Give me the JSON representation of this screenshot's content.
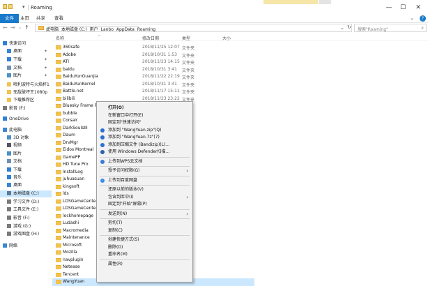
{
  "window": {
    "title": "Roaming",
    "controls": [
      "—",
      "☐",
      "✕"
    ]
  },
  "ribbon": {
    "tabs": [
      "文件",
      "主页",
      "共享",
      "查看"
    ],
    "expand": "⌄",
    "help": "?"
  },
  "address": {
    "breadcrumbs": [
      "此电脑",
      "本地磁盘 (C:)",
      "用户",
      "Lanbo",
      "AppData",
      "Roaming"
    ],
    "search_placeholder": "搜索\"Roaming\""
  },
  "sidebar": {
    "items": [
      {
        "label": "快速访问",
        "icon": "star-icon",
        "color": "#2f7fd6"
      },
      {
        "label": "桌面",
        "icon": "desktop-icon",
        "color": "#3b86d4",
        "pin": "✦"
      },
      {
        "label": "下载",
        "icon": "download-icon",
        "color": "#2f7fd6",
        "pin": "✦"
      },
      {
        "label": "文档",
        "icon": "document-icon",
        "color": "#6f8fb6",
        "pin": "✦"
      },
      {
        "label": "图片",
        "icon": "picture-icon",
        "color": "#4a90c8",
        "pin": "✦"
      },
      {
        "label": "哈利波特与火焰杯1",
        "icon": "folder-icon",
        "color": "#f2c14e"
      },
      {
        "label": "无敌破坏王1080p",
        "icon": "folder-icon",
        "color": "#f2c14e"
      },
      {
        "label": "下载推荐区",
        "icon": "folder-icon",
        "color": "#f2c14e"
      },
      {
        "label": "影音 (F:)",
        "icon": "drive-icon",
        "color": "#7a7a7a"
      },
      {
        "label": "OneDrive",
        "icon": "cloud-icon",
        "color": "#2f7fd6"
      },
      {
        "label": "此电脑",
        "icon": "computer-icon",
        "color": "#3b86d4"
      },
      {
        "label": "3D 对象",
        "icon": "cube-icon",
        "color": "#4a90c8"
      },
      {
        "label": "视频",
        "icon": "video-icon",
        "color": "#556"
      },
      {
        "label": "图片",
        "icon": "picture-icon",
        "color": "#4a90c8"
      },
      {
        "label": "文档",
        "icon": "document-icon",
        "color": "#6f8fb6"
      },
      {
        "label": "下载",
        "icon": "download-icon",
        "color": "#2f7fd6"
      },
      {
        "label": "音乐",
        "icon": "music-icon",
        "color": "#2f7fd6"
      },
      {
        "label": "桌面",
        "icon": "desktop-icon",
        "color": "#3b86d4"
      },
      {
        "label": "本地磁盘 (C:)",
        "icon": "drive-icon",
        "color": "#5a7a9a",
        "selected": true
      },
      {
        "label": "学习文件 (D:)",
        "icon": "drive-icon",
        "color": "#7a7a7a"
      },
      {
        "label": "工具文件 (E:)",
        "icon": "drive-icon",
        "color": "#7a7a7a"
      },
      {
        "label": "影音 (F:)",
        "icon": "drive-icon",
        "color": "#7a7a7a"
      },
      {
        "label": "游戏 (G:)",
        "icon": "drive-icon",
        "color": "#7a7a7a"
      },
      {
        "label": "游戏图盘 (H:)",
        "icon": "drive-icon",
        "color": "#7a7a7a"
      },
      {
        "label": "网络",
        "icon": "network-icon",
        "color": "#3b86d4"
      }
    ]
  },
  "columns": {
    "name": "名称",
    "date": "修改日期",
    "type": "类型",
    "size": "大小"
  },
  "files": [
    {
      "name": "360safe",
      "date": "2018/11/25 12:07",
      "type": "文件夹"
    },
    {
      "name": "Adobe",
      "date": "2018/10/31 1:53",
      "type": "文件夹"
    },
    {
      "name": "ATI",
      "date": "2018/11/23 14:15",
      "type": "文件夹"
    },
    {
      "name": "baidu",
      "date": "2018/10/31 3:41",
      "type": "文件夹"
    },
    {
      "name": "BaiduYunGuanjia",
      "date": "2018/11/22 22:19",
      "type": "文件夹"
    },
    {
      "name": "BaiduYunKernel",
      "date": "2018/10/31 3:41",
      "type": "文件夹"
    },
    {
      "name": "Battle.net",
      "date": "2018/11/17 15:11",
      "type": "文件夹"
    },
    {
      "name": "bilibili",
      "date": "2018/11/23 23:22",
      "type": "文件夹"
    },
    {
      "name": "Bluesky Frame Ra",
      "date": "",
      "type": ""
    },
    {
      "name": "bubble",
      "date": "",
      "type": ""
    },
    {
      "name": "Corsair",
      "date": "",
      "type": ""
    },
    {
      "name": "DarkSoulsIII",
      "date": "",
      "type": ""
    },
    {
      "name": "Daum",
      "date": "",
      "type": ""
    },
    {
      "name": "DrvMgr",
      "date": "",
      "type": ""
    },
    {
      "name": "Eidos Montreal",
      "date": "",
      "type": ""
    },
    {
      "name": "GamePP",
      "date": "",
      "type": ""
    },
    {
      "name": "HD Tune Pro",
      "date": "",
      "type": ""
    },
    {
      "name": "InstallLog",
      "date": "",
      "type": ""
    },
    {
      "name": "juhuasuan",
      "date": "",
      "type": ""
    },
    {
      "name": "kingsoft",
      "date": "",
      "type": ""
    },
    {
      "name": "lds",
      "date": "",
      "type": ""
    },
    {
      "name": "LDSGameCenter",
      "date": "",
      "type": ""
    },
    {
      "name": "LDSGameCenterS",
      "date": "",
      "type": ""
    },
    {
      "name": "lockhomepage",
      "date": "",
      "type": ""
    },
    {
      "name": "Ludashi",
      "date": "",
      "type": ""
    },
    {
      "name": "Macromedia",
      "date": "",
      "type": ""
    },
    {
      "name": "Maintenance",
      "date": "",
      "type": ""
    },
    {
      "name": "Microsoft",
      "date": "",
      "type": ""
    },
    {
      "name": "Mozilla",
      "date": "",
      "type": ""
    },
    {
      "name": "navplugin",
      "date": "",
      "type": ""
    },
    {
      "name": "Netease",
      "date": "",
      "type": ""
    },
    {
      "name": "Tencent",
      "date": "",
      "type": ""
    },
    {
      "name": "WangYuan",
      "date": "",
      "type": "",
      "selected": true
    }
  ],
  "context_menu": {
    "items": [
      {
        "label": "打开(O)",
        "bold": true
      },
      {
        "label": "在新窗口中打开(E)"
      },
      {
        "label": "固定到\"快速访问\""
      },
      {
        "label": "添加到 \"WangYuan.zip\"(Q)",
        "icon": "bandizip-icon",
        "icon_color": "#2a6fd1"
      },
      {
        "label": "添加到 \"WangYuan.7z\"(7)",
        "icon": "bandizip-icon",
        "icon_color": "#2a6fd1"
      },
      {
        "label": "添加到压缩文件 (Bandizip)(L)...",
        "icon": "bandizip-icon",
        "icon_color": "#2a6fd1"
      },
      {
        "label": "使用 Windows Defender扫描...",
        "icon": "defender-icon",
        "icon_color": "#2f5fb0"
      },
      {
        "sep": true
      },
      {
        "label": "上传到WPS云文档",
        "icon": "wps-cloud-icon",
        "icon_color": "#3a7bd5"
      },
      {
        "sep": true
      },
      {
        "label": "授予访问权限(G)",
        "arrow": "›"
      },
      {
        "sep": true
      },
      {
        "label": "上传到百度网盘",
        "icon": "baidu-netdisk-icon",
        "icon_color": "#3b8ee8"
      },
      {
        "sep": true
      },
      {
        "label": "还原以前的版本(V)"
      },
      {
        "label": "包含到库中(I)",
        "arrow": "›"
      },
      {
        "label": "固定到\"开始\"屏幕(P)"
      },
      {
        "sep": true
      },
      {
        "label": "发送到(N)",
        "arrow": "›"
      },
      {
        "sep": true
      },
      {
        "label": "剪切(T)"
      },
      {
        "label": "复制(C)"
      },
      {
        "sep": true
      },
      {
        "label": "创建快捷方式(S)"
      },
      {
        "label": "删除(D)"
      },
      {
        "label": "重命名(M)"
      },
      {
        "sep": true
      },
      {
        "label": "属性(R)"
      }
    ]
  }
}
